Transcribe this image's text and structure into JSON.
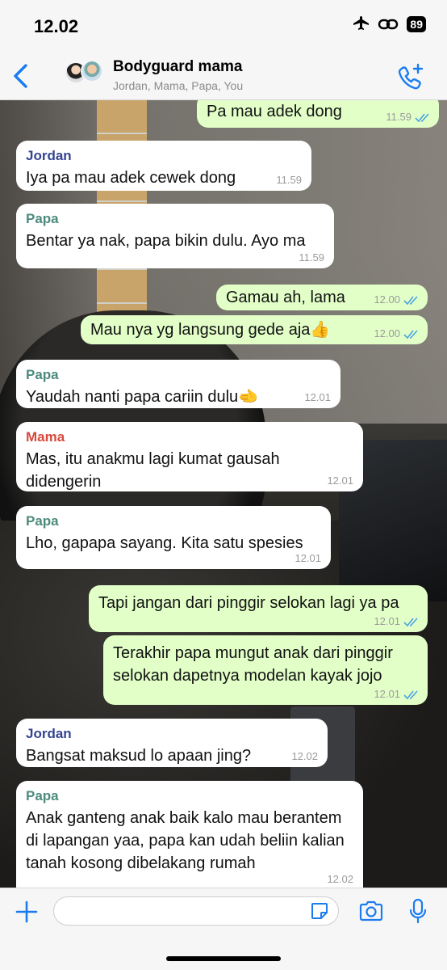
{
  "status_bar": {
    "time": "12.02",
    "battery": "89"
  },
  "header": {
    "title": "Bodyguard mama",
    "subtitle": "Jordan, Mama, Papa, You"
  },
  "messages": [
    {
      "dir": "out",
      "text": "Pa mau adek dong",
      "time": "11.59"
    },
    {
      "dir": "in",
      "sender": "Jordan",
      "text": "Iya pa mau adek cewek dong",
      "time": "11.59"
    },
    {
      "dir": "in",
      "sender": "Papa",
      "text": "Bentar ya nak, papa bikin dulu. Ayo ma",
      "time": "11.59"
    },
    {
      "dir": "out",
      "text": "Gamau ah, lama",
      "time": "12.00"
    },
    {
      "dir": "out",
      "text": "Mau nya yg langsung gede aja👍",
      "time": "12.00"
    },
    {
      "dir": "in",
      "sender": "Papa",
      "text": "Yaudah nanti papa cariin dulu🫲",
      "time": "12.01"
    },
    {
      "dir": "in",
      "sender": "Mama",
      "text": "Mas, itu anakmu lagi kumat gausah didengerin",
      "time": "12.01"
    },
    {
      "dir": "in",
      "sender": "Papa",
      "text": "Lho, gapapa sayang. Kita satu spesies",
      "time": "12.01"
    },
    {
      "dir": "out",
      "text": "Tapi jangan dari pinggir selokan lagi ya pa",
      "time": "12.01"
    },
    {
      "dir": "out",
      "text": "Terakhir papa mungut anak dari pinggir selokan dapetnya modelan kayak jojo",
      "time": "12.01"
    },
    {
      "dir": "in",
      "sender": "Jordan",
      "text": "Bangsat maksud lo apaan jing?",
      "time": "12.02"
    },
    {
      "dir": "in",
      "sender": "Papa",
      "text": "Anak ganteng anak baik kalo mau berantem di lapangan yaa, papa kan udah beliin kalian tanah kosong dibelakang rumah",
      "time": "12.02"
    }
  ],
  "input": {
    "placeholder": ""
  },
  "icons": {
    "back": "chevron-left-icon",
    "call": "add-call-icon",
    "plus": "plus-icon",
    "sticker": "sticker-icon",
    "camera": "camera-icon",
    "mic": "microphone-icon"
  },
  "colors": {
    "accent": "#1a7cf0",
    "outgoing_bubble": "#e2ffc8",
    "incoming_bubble": "#ffffff",
    "jordan": "#35448f",
    "papa": "#4c8b7c",
    "mama": "#d8483c",
    "read_ticks": "#4aa4e0"
  }
}
